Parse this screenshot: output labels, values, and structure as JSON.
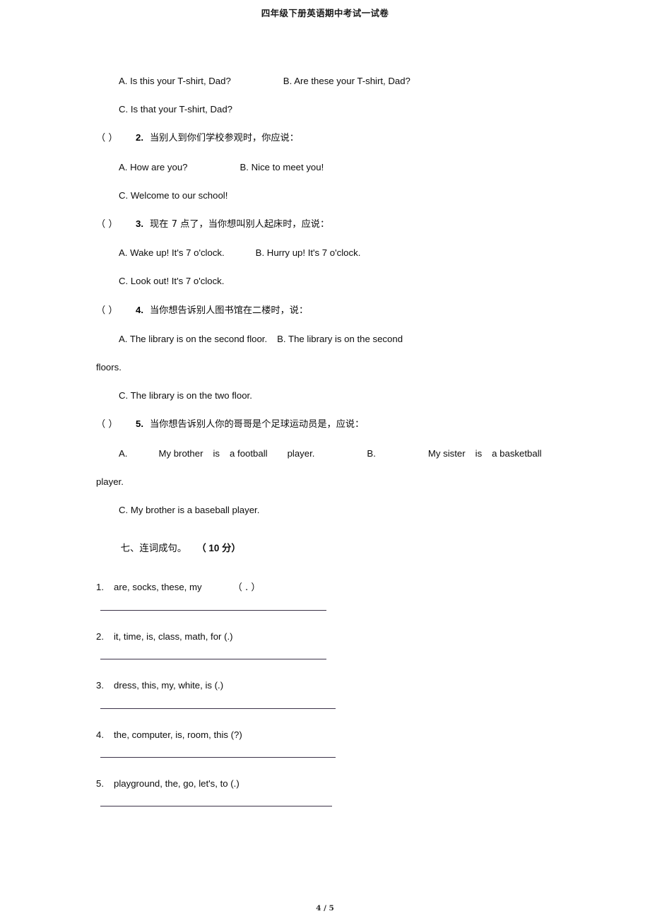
{
  "document": {
    "header_title": "四年级下册英语期中考试一试卷",
    "footer_page": "4 / 5"
  },
  "questions": [
    {
      "id": "q1-continuation",
      "options": {
        "a": "A. Is this your T-shirt, Dad?",
        "b": "B. Are these your T-shirt, Dad?",
        "c": "C. Is that your T-shirt, Dad?"
      }
    },
    {
      "id": "q2",
      "bracket": "（     ）",
      "number": "2.",
      "stem": "当别人到你们学校参观时，你应说：",
      "options": {
        "a": "A. How are you?",
        "b": "B. Nice to meet you!",
        "c": "C. Welcome to our school!"
      }
    },
    {
      "id": "q3",
      "bracket": "（     ）",
      "number": "3.",
      "stem": "现在 7 点了，当你想叫别人起床时，应说：",
      "options": {
        "a": "A. Wake up! It's 7 o'clock.",
        "b": "B. Hurry up! It's 7 o'clock.",
        "c": "C. Look out! It's 7 o'clock."
      }
    },
    {
      "id": "q4",
      "bracket": "（     ）",
      "number": "4.",
      "stem": "当你想告诉别人图书馆在二楼时，说：",
      "options": {
        "a": "A. The library is on the second floor.",
        "b": "B. The library is on the second",
        "b_wrap": "floors.",
        "c": "C. The library is on the two floor."
      }
    },
    {
      "id": "q5",
      "bracket": "（     ）",
      "number": "5.",
      "stem": "当你想告诉别人你的哥哥是个足球运动员是，应说：",
      "options": {
        "a_label": "A.",
        "a_part1": "My brother",
        "a_part2": "is",
        "a_part3": "a football",
        "a_part4": "player.",
        "b_label": "B.",
        "b_part1": "My sister",
        "b_part2": "is",
        "b_part3": "a basketball",
        "b_wrap": "player.",
        "c": "C. My brother is a baseball player."
      }
    }
  ],
  "section_seven": {
    "heading_title": "七、连词成句。",
    "heading_score": "（ 10 分）",
    "items": [
      {
        "number": "1.",
        "words": "are, socks, these, my",
        "punct": "（ . ）"
      },
      {
        "number": "2.",
        "words": "it, time, is, class, math, for (.)",
        "punct": ""
      },
      {
        "number": "3.",
        "words": "dress, this, my, white, is (.)",
        "punct": ""
      },
      {
        "number": "4.",
        "words": "the, computer, is, room, this (?)",
        "punct": ""
      },
      {
        "number": "5.",
        "words": "playground, the, go, let's, to (.)",
        "punct": ""
      }
    ]
  }
}
